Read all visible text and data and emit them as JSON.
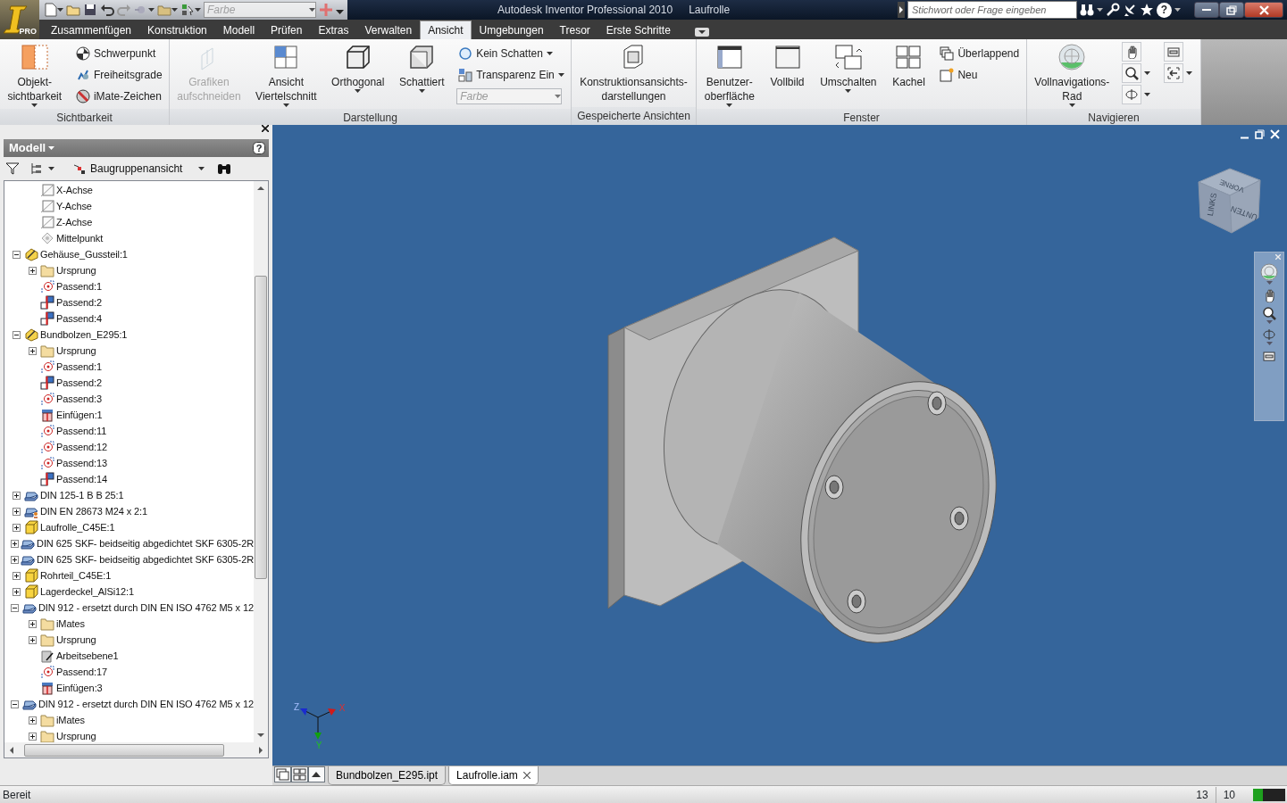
{
  "title_bar": {
    "app_badge": "PRO",
    "color_combo": {
      "value": "Farbe",
      "disabled": true
    },
    "title": "Autodesk Inventor Professional 2010",
    "document": "Laufrolle",
    "search": {
      "placeholder": "Stichwort oder Frage eingeben"
    },
    "help": "?"
  },
  "ribbon": {
    "tabs": [
      {
        "label": "Zusammenfügen",
        "selected": false
      },
      {
        "label": "Konstruktion",
        "selected": false
      },
      {
        "label": "Modell",
        "selected": false
      },
      {
        "label": "Prüfen",
        "selected": false
      },
      {
        "label": "Extras",
        "selected": false
      },
      {
        "label": "Verwalten",
        "selected": false
      },
      {
        "label": "Ansicht",
        "selected": true
      },
      {
        "label": "Umgebungen",
        "selected": false
      },
      {
        "label": "Tresor",
        "selected": false
      },
      {
        "label": "Erste Schritte",
        "selected": false
      }
    ],
    "panels": [
      {
        "title": "Sichtbarkeit",
        "items": [
          {
            "kind": "large",
            "label": "Objekt-\nsichtbarkeit",
            "dropdown": true,
            "disabled": false
          },
          {
            "kind": "stack",
            "items": [
              {
                "kind": "small",
                "label": "Schwerpunkt",
                "dropdown": false
              },
              {
                "kind": "small",
                "label": "Freiheitsgrade",
                "dropdown": false
              },
              {
                "kind": "small",
                "label": "iMate-Zeichen",
                "dropdown": false
              }
            ]
          }
        ]
      },
      {
        "title": "Darstellung",
        "items": [
          {
            "kind": "large",
            "label": "Grafiken\naufschneiden",
            "dropdown": false,
            "disabled": true
          },
          {
            "kind": "large",
            "label": "Ansicht\nViertelschnitt",
            "dropdown": true,
            "disabled": false
          },
          {
            "kind": "large",
            "label": "Orthogonal",
            "dropdown": true,
            "disabled": false
          },
          {
            "kind": "large",
            "label": "Schattiert",
            "dropdown": true,
            "disabled": false
          },
          {
            "kind": "stack",
            "items": [
              {
                "kind": "small",
                "label": "Kein Schatten",
                "dropdown": true
              },
              {
                "kind": "small",
                "label": "Transparenz Ein",
                "dropdown": true
              },
              {
                "kind": "combo",
                "value": "Farbe",
                "disabled": true
              }
            ]
          }
        ]
      },
      {
        "title": "Gespeicherte Ansichten",
        "items": [
          {
            "kind": "large",
            "label": "Konstruktionsansichts-\ndarstellungen",
            "dropdown": false,
            "disabled": false
          }
        ]
      },
      {
        "title": "Fenster",
        "items": [
          {
            "kind": "large",
            "label": "Benutzer-\noberfläche",
            "dropdown": true,
            "disabled": false
          },
          {
            "kind": "large",
            "label": "Vollbild",
            "dropdown": false,
            "disabled": false
          },
          {
            "kind": "large",
            "label": "Umschalten",
            "dropdown": true,
            "disabled": false
          },
          {
            "kind": "large",
            "label": "Kachel",
            "dropdown": false,
            "disabled": false
          },
          {
            "kind": "stack",
            "items": [
              {
                "kind": "small",
                "label": "Überlappend",
                "dropdown": false
              },
              {
                "kind": "small",
                "label": "Neu",
                "dropdown": false
              }
            ]
          }
        ]
      },
      {
        "title": "Navigieren",
        "items": [
          {
            "kind": "large",
            "label": "Vollnavigations-\nRad",
            "dropdown": true,
            "disabled": false
          },
          {
            "kind": "icons",
            "items": [
              {
                "dropdown": false
              },
              {
                "dropdown": true
              },
              {
                "dropdown": true
              }
            ]
          },
          {
            "kind": "icons",
            "items": [
              {
                "dropdown": false
              },
              {
                "dropdown": true
              }
            ]
          }
        ]
      }
    ]
  },
  "browser": {
    "title": "Modell",
    "help": "?",
    "view": "Baugruppenansicht",
    "tree": [
      {
        "children": [
          {
            "label": "X-Achse",
            "kind": "axis"
          },
          {
            "label": "Y-Achse",
            "kind": "axis"
          },
          {
            "label": "Z-Achse",
            "kind": "axis"
          },
          {
            "label": "Mittelpunkt",
            "kind": "point"
          }
        ]
      },
      {
        "label": "Gehäuse_Gussteil:1",
        "kind": "assembly",
        "expanded": true,
        "children": [
          {
            "label": "Ursprung",
            "kind": "folder",
            "expanded": false
          },
          {
            "label": "Passend:1",
            "kind": "mate"
          },
          {
            "label": "Passend:2",
            "kind": "flush"
          },
          {
            "label": "Passend:4",
            "kind": "flush"
          }
        ]
      },
      {
        "label": "Bundbolzen_E295:1",
        "kind": "assembly",
        "expanded": true,
        "children": [
          {
            "label": "Ursprung",
            "kind": "folder",
            "expanded": false
          },
          {
            "label": "Passend:1",
            "kind": "mate"
          },
          {
            "label": "Passend:2",
            "kind": "flush"
          },
          {
            "label": "Passend:3",
            "kind": "mate"
          },
          {
            "label": "Einfügen:1",
            "kind": "insert"
          },
          {
            "label": "Passend:11",
            "kind": "mate"
          },
          {
            "label": "Passend:12",
            "kind": "mate"
          },
          {
            "label": "Passend:13",
            "kind": "mate"
          },
          {
            "label": "Passend:14",
            "kind": "flush"
          }
        ]
      },
      {
        "label": "DIN 125-1 B B 25:1",
        "kind": "library-part",
        "expanded": false
      },
      {
        "label": "DIN EN 28673 M24 x 2:1",
        "kind": "library-part-pinned",
        "expanded": false
      },
      {
        "label": "Laufrolle_C45E:1",
        "kind": "part",
        "expanded": false
      },
      {
        "label": "DIN 625 SKF- beidseitig abgedichtet SKF 6305-2R",
        "kind": "library-part",
        "expanded": false
      },
      {
        "label": "DIN 625 SKF- beidseitig abgedichtet SKF 6305-2R",
        "kind": "library-part",
        "expanded": false
      },
      {
        "label": "Rohrteil_C45E:1",
        "kind": "part",
        "expanded": false
      },
      {
        "label": "Lagerdeckel_AlSi12:1",
        "kind": "part",
        "expanded": false
      },
      {
        "label": "DIN 912 - ersetzt durch DIN EN ISO 4762 M5 x 12",
        "kind": "library-part",
        "expanded": true,
        "children": [
          {
            "label": "iMates",
            "kind": "folder",
            "expanded": false
          },
          {
            "label": "Ursprung",
            "kind": "folder",
            "expanded": false
          },
          {
            "label": "Arbeitsebene1",
            "kind": "workplane"
          },
          {
            "label": "Passend:17",
            "kind": "mate"
          },
          {
            "label": "Einfügen:3",
            "kind": "insert"
          }
        ]
      },
      {
        "label": "DIN 912 - ersetzt durch DIN EN ISO 4762 M5 x 12",
        "kind": "library-part",
        "expanded": true,
        "children": [
          {
            "label": "iMates",
            "kind": "folder",
            "expanded": false
          },
          {
            "label": "Ursprung",
            "kind": "folder",
            "expanded": false
          }
        ]
      }
    ]
  },
  "viewport": {
    "view_cube": [
      "LINKS",
      "VORNE",
      "UNTEN"
    ],
    "axes": [
      "X",
      "Y",
      "Z"
    ]
  },
  "document_tabs": [
    {
      "label": "Bundbolzen_E295.ipt",
      "selected": false
    },
    {
      "label": "Laufrolle.iam",
      "selected": true
    }
  ],
  "status_bar": {
    "message": "Bereit",
    "readouts": [
      "13",
      "10"
    ],
    "level": 0.3
  }
}
